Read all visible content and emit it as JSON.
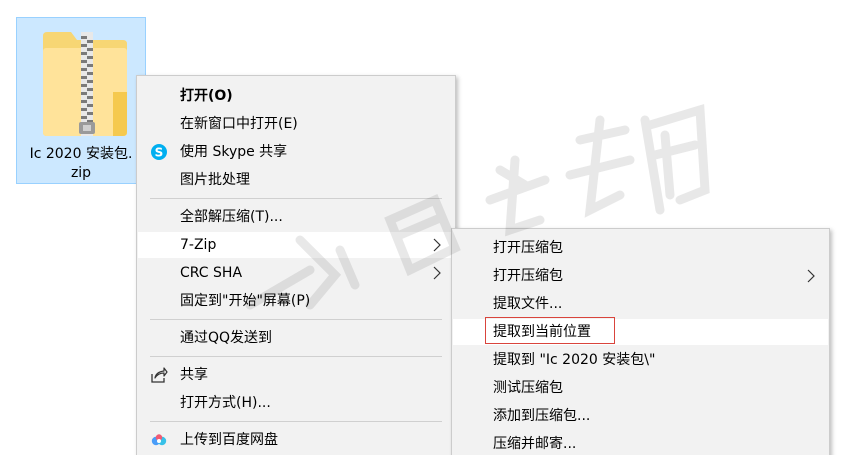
{
  "file": {
    "name": "Ic 2020 安装包.\nzip",
    "icon": "zip-folder-icon",
    "selection_color": "#cce8ff"
  },
  "context_menu": {
    "items": [
      {
        "label": "打开(O)",
        "bold": true
      },
      {
        "label": "在新窗口中打开(E)"
      },
      {
        "label": "使用 Skype 共享",
        "icon": "skype-icon"
      },
      {
        "label": "图片批处理"
      },
      {
        "label": "全部解压缩(T)..."
      },
      {
        "label": "7-Zip",
        "submenu": true,
        "active": true
      },
      {
        "label": "CRC SHA",
        "submenu": true
      },
      {
        "label": "固定到\"开始\"屏幕(P)"
      },
      {
        "label": "通过QQ发送到"
      },
      {
        "label": "共享",
        "icon": "share-icon"
      },
      {
        "label": "打开方式(H)..."
      },
      {
        "label": "上传到百度网盘",
        "icon": "baidu-netdisk-icon"
      }
    ]
  },
  "sevenzip_menu": {
    "items": [
      {
        "label": "打开压缩包"
      },
      {
        "label": "打开压缩包",
        "submenu": true
      },
      {
        "label": "提取文件..."
      },
      {
        "label": "提取到当前位置",
        "highlighted": true
      },
      {
        "label": "提取到 \"Ic 2020 安装包\\\""
      },
      {
        "label": "测试压缩包"
      },
      {
        "label": "添加到压缩包..."
      },
      {
        "label": "压缩并邮寄..."
      }
    ]
  },
  "colors": {
    "menu_bg": "#f2f2f2",
    "hover_bg": "#ffffff",
    "highlight_border": "#d9443c",
    "skype": "#00aff0"
  }
}
